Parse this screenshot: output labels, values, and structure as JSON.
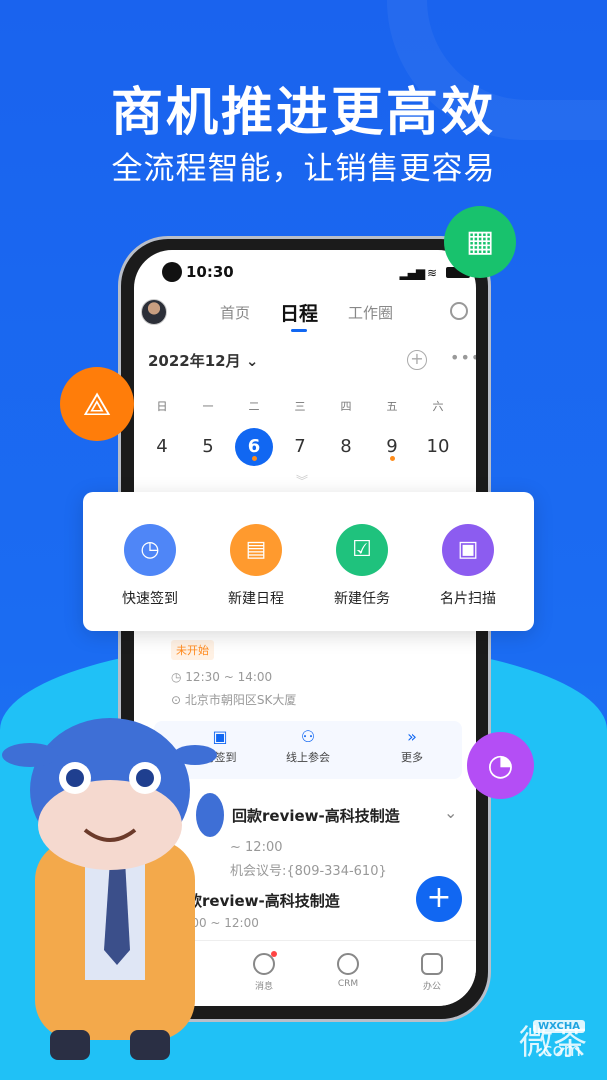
{
  "headline": "商机推进更高效",
  "subheadline": "全流程智能，让销售更容易",
  "status": {
    "time": "10:30"
  },
  "header": {
    "tabs": [
      "首页",
      "日程",
      "工作圈"
    ],
    "active_tab": "日程"
  },
  "calendar": {
    "month": "2022年12月",
    "weekdays": [
      "日",
      "一",
      "二",
      "三",
      "四",
      "五",
      "六"
    ],
    "days": [
      "4",
      "5",
      "6",
      "7",
      "8",
      "9",
      "10"
    ],
    "selected": "6",
    "event_days": [
      "6",
      "9"
    ]
  },
  "quick_actions": [
    {
      "label": "快速签到",
      "icon": "location-clock-icon",
      "color": "#4f86f7"
    },
    {
      "label": "新建日程",
      "icon": "calendar-plus-icon",
      "color": "#ff9a2e"
    },
    {
      "label": "新建任务",
      "icon": "clipboard-check-icon",
      "color": "#1fc27d"
    },
    {
      "label": "名片扫描",
      "icon": "card-scan-icon",
      "color": "#8c5cf0"
    }
  ],
  "event1": {
    "status": "未开始",
    "time": "12:30 ~ 14:00",
    "location": "北京市朝阳区SK大厦",
    "actions": [
      "访签到",
      "线上参会",
      "更多"
    ]
  },
  "event2": {
    "title": "回款review-高科技制造",
    "time": "~ 12:00",
    "meeting": "机会议号:{809-334-610}"
  },
  "event3": {
    "title": "回款review-高科技制造",
    "time": "11:00 ~ 12:00"
  },
  "bottom_nav": [
    "页",
    "消息",
    "CRM",
    "办公"
  ],
  "watermark": {
    "text": "微茶",
    "badge": "WXCHA",
    "domain": ".com"
  },
  "colors": {
    "primary": "#1167f2",
    "background": "#1b6cf2",
    "accent_wave": "#20c1f6",
    "status_orange": "#ff8a1e"
  }
}
